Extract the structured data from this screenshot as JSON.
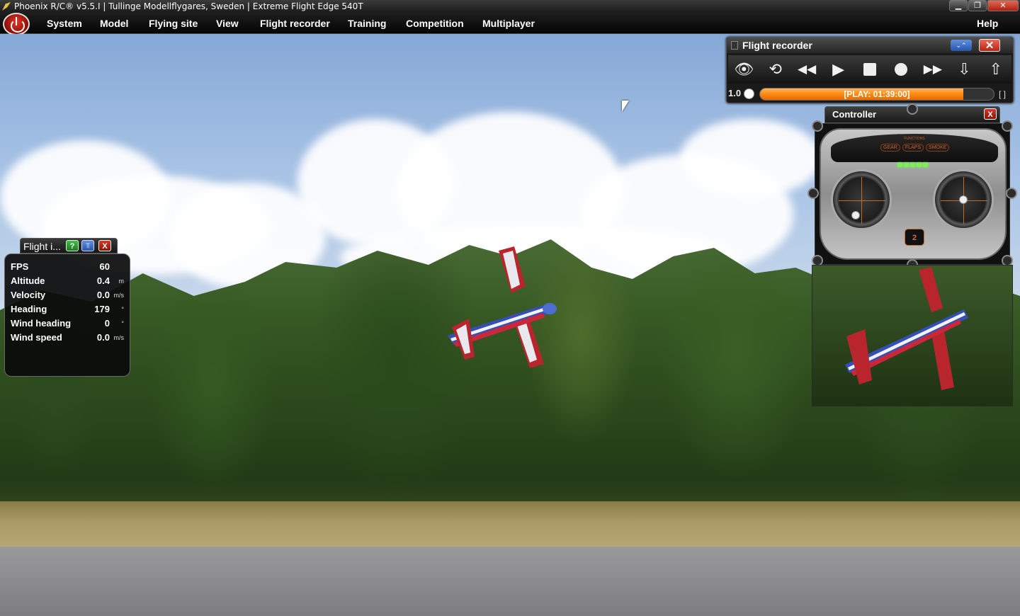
{
  "window": {
    "title": "Phoenix R/C® v5.5.I | Tullinge Modellflygares, Sweden | Extreme Flight Edge 540T",
    "minimize": "▁",
    "restore": "❐",
    "close": "✕"
  },
  "menu": {
    "items": [
      "System",
      "Model",
      "Flying site",
      "View",
      "Flight recorder",
      "Training",
      "Competition",
      "Multiplayer"
    ],
    "help": "Help"
  },
  "flight_recorder": {
    "title": "Flight recorder",
    "collapse_label": "⌄⌃",
    "close_label": "✕",
    "buttons": {
      "view": "👁",
      "loop": "⟲",
      "rewind": "◀◀",
      "play": "▶",
      "stop": "■",
      "record": "●",
      "fast_forward": "▶▶",
      "import": "⇩",
      "export": "⇧"
    },
    "speed": "1.0",
    "progress_label": "[PLAY: 01:39:00]",
    "progress_fraction": 0.87,
    "bracket": "[ ]"
  },
  "controller": {
    "title": "Controller",
    "close_label": "X",
    "functions_label": "FUNCTIONS",
    "function_buttons": [
      "GEAR",
      "FLAPS",
      "SMOKE"
    ],
    "mode_label": "MODE",
    "mode_value": "2"
  },
  "flight_info": {
    "title": "Flight i...",
    "help_label": "?",
    "pin_label": "⫪",
    "close_label": "X",
    "rows": [
      {
        "label": "FPS",
        "value": "60",
        "unit": ""
      },
      {
        "label": "Altitude",
        "value": "0.4",
        "unit": "m"
      },
      {
        "label": "Velocity",
        "value": "0.0",
        "unit": "m/s"
      },
      {
        "label": "Heading",
        "value": "179",
        "unit": "°"
      },
      {
        "label": "Wind heading",
        "value": "0",
        "unit": "°"
      },
      {
        "label": "Wind speed",
        "value": "0.0",
        "unit": "m/s"
      }
    ]
  },
  "colors": {
    "progress_orange": "#ff8a10",
    "close_red": "#c0301c",
    "help_green": "#2ea635",
    "pin_blue": "#3b6cc4"
  }
}
